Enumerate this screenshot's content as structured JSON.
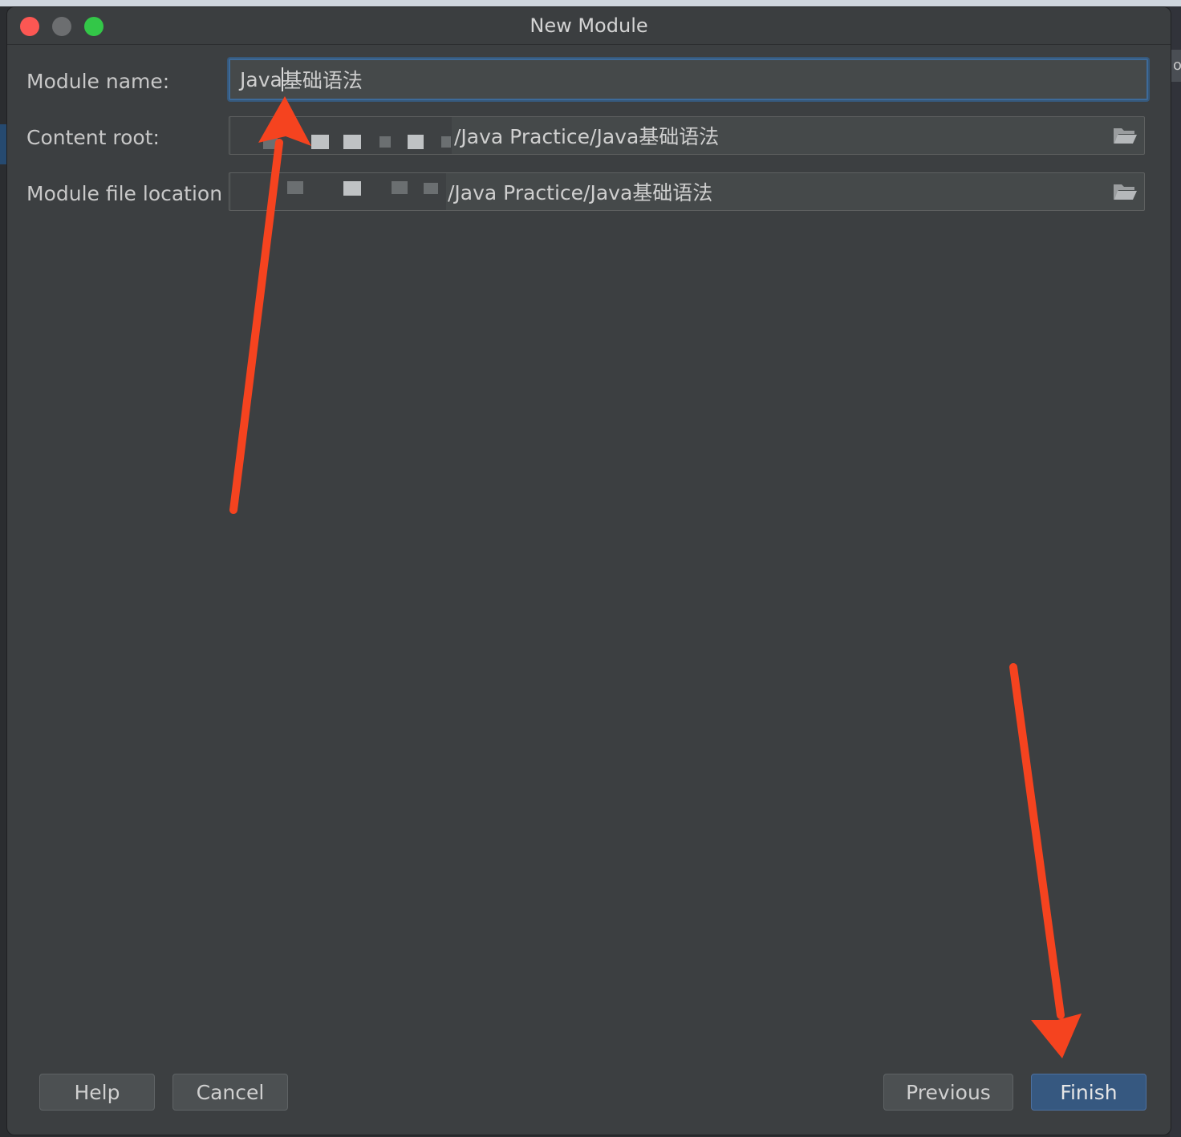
{
  "window": {
    "title": "New Module"
  },
  "form": {
    "module_name": {
      "label": "Module name:",
      "value_before_caret": "Java",
      "value_after_caret": "基础语法"
    },
    "content_root": {
      "label": "Content root:",
      "value_visible": "/Java Practice/Java基础语法"
    },
    "module_file_location": {
      "label": "Module file location",
      "value_visible": "/Java Practice/Java基础语法"
    }
  },
  "buttons": {
    "help": "Help",
    "cancel": "Cancel",
    "previous": "Previous",
    "finish": "Finish"
  },
  "colors": {
    "dialog_bg": "#3c3f41",
    "accent": "#365880",
    "annotation_arrow": "#f5431f"
  },
  "icons": {
    "folder": "folder-open-icon"
  },
  "backdrop": {
    "right_tab_text": "o"
  }
}
